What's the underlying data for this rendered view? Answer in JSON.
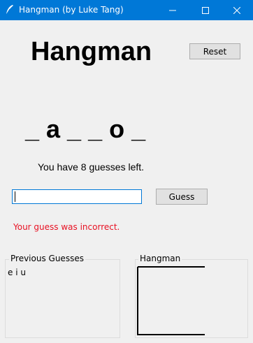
{
  "window": {
    "title": "Hangman (by Luke Tang)",
    "icons": {
      "app": "feather-icon",
      "minimize": "minimize-icon",
      "maximize": "maximize-icon",
      "close": "close-icon"
    },
    "colors": {
      "titlebar": "#0078d7",
      "error_text": "#e81123"
    }
  },
  "game": {
    "heading": "Hangman",
    "reset_label": "Reset",
    "word_display": "_ a _ _ o _",
    "guesses_remaining_text": "You have 8 guesses left.",
    "guess_input_value": "",
    "guess_button_label": "Guess",
    "feedback": "Your guess was incorrect."
  },
  "previous_guesses": {
    "label": "Previous Guesses",
    "letters": "e i u"
  },
  "hangman_panel": {
    "label": "Hangman"
  }
}
